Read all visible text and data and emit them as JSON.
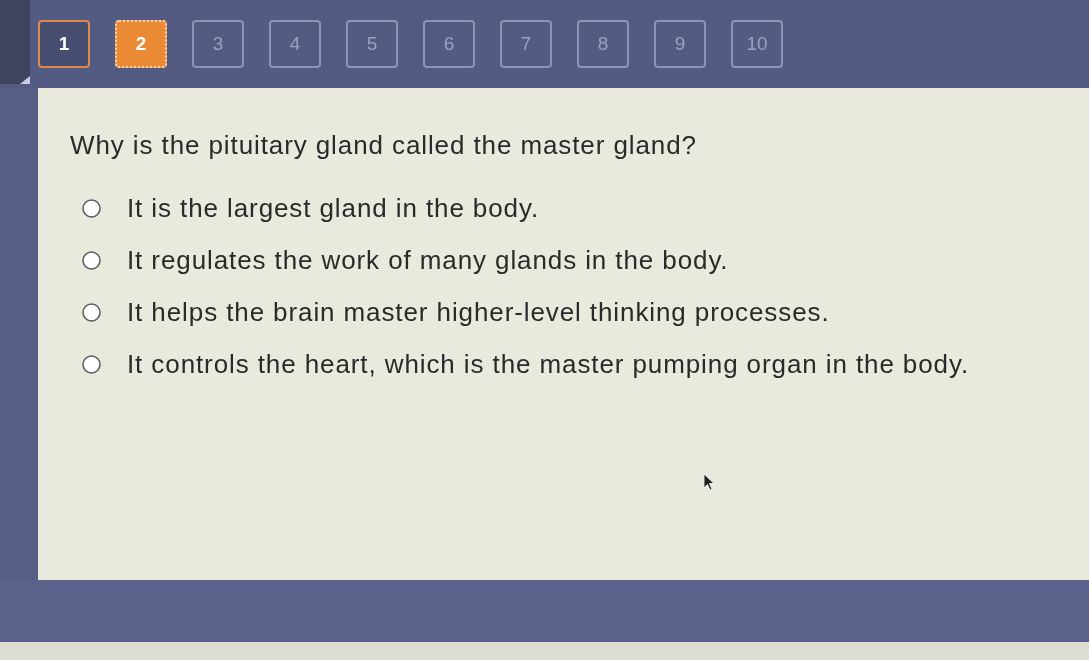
{
  "question_nav": [
    {
      "label": "1",
      "selected": false,
      "answered": true
    },
    {
      "label": "2",
      "selected": true,
      "answered": false
    },
    {
      "label": "3",
      "selected": false,
      "answered": false
    },
    {
      "label": "4",
      "selected": false,
      "answered": false
    },
    {
      "label": "5",
      "selected": false,
      "answered": false
    },
    {
      "label": "6",
      "selected": false,
      "answered": false
    },
    {
      "label": "7",
      "selected": false,
      "answered": false
    },
    {
      "label": "8",
      "selected": false,
      "answered": false
    },
    {
      "label": "9",
      "selected": false,
      "answered": false
    },
    {
      "label": "10",
      "selected": false,
      "answered": false
    }
  ],
  "question": {
    "text": "Why is the pituitary gland called the master gland?",
    "options": [
      {
        "text": "It is the largest gland in the body.",
        "selected": false
      },
      {
        "text": "It regulates the work of many glands in the body.",
        "selected": false
      },
      {
        "text": "It helps the brain master higher-level thinking processes.",
        "selected": false
      },
      {
        "text": "It controls the heart, which is the master pumping organ in the body.",
        "selected": false
      }
    ]
  }
}
